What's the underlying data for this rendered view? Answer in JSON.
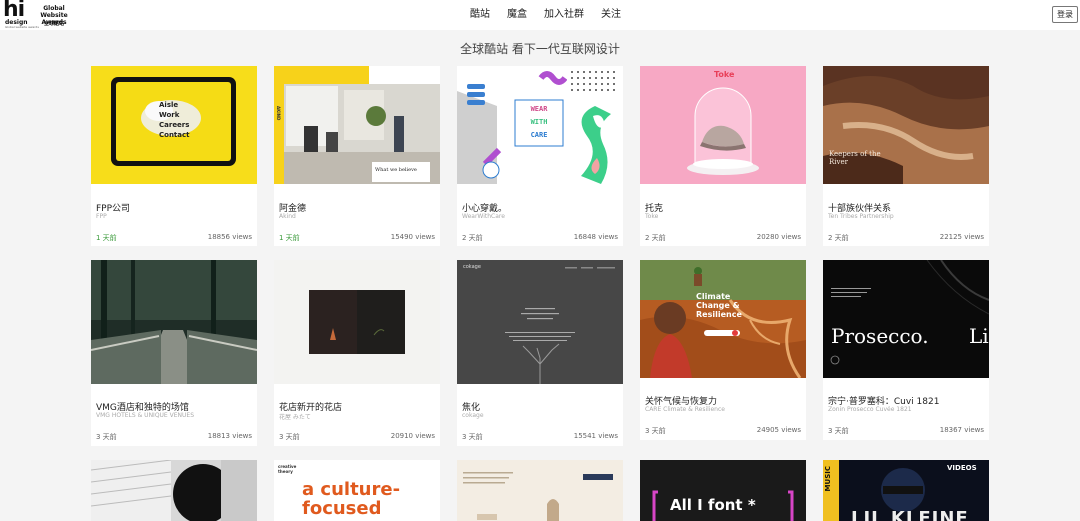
{
  "logo": {
    "hi": "hi",
    "design": "design",
    "tag": "Global website awards",
    "gwa": "Global Website Awards",
    "cn": "全球酷站"
  },
  "nav": {
    "items": [
      "酷站",
      "魔盒",
      "加入社群",
      "关注"
    ],
    "login": "登录"
  },
  "subtitle": "全球酷站 看下一代互联网设计",
  "cards": [
    {
      "title": "FPP公司",
      "sub": "FPP",
      "age": "1 天前",
      "age_new": true,
      "views": "18856 views",
      "thumb": {
        "menu": [
          "Aisle",
          "Work",
          "Careers",
          "Contact"
        ]
      }
    },
    {
      "title": "阿金德",
      "sub": "Akind",
      "age": "1 天前",
      "age_new": true,
      "views": "15490 views",
      "thumb": {
        "brand": "AKIND",
        "caption": "What we believe"
      }
    },
    {
      "title": "小心穿戴。",
      "sub": "WearWithCare",
      "age": "2 天前",
      "age_new": false,
      "views": "16848 views",
      "thumb": {
        "line1": "WEAR",
        "line2": "WITH",
        "line3": "CARE"
      }
    },
    {
      "title": "托克",
      "sub": "Toke",
      "age": "2 天前",
      "age_new": false,
      "views": "20280 views",
      "thumb": {
        "brand": "Toke"
      }
    },
    {
      "title": "十部族伙伴关系",
      "sub": "Ten Tribes Partnership",
      "age": "2 天前",
      "age_new": false,
      "views": "22125 views",
      "thumb": {
        "caption": "Keepers of the River"
      }
    },
    {
      "title": "VMG酒店和独特的场馆",
      "sub": "VMG HOTELS & UNIQUE VENUES",
      "age": "3 天前",
      "age_new": false,
      "views": "18813 views",
      "thumb": {}
    },
    {
      "title": "花店新开的花店",
      "sub": "花屋 みたて",
      "age": "3 天前",
      "age_new": false,
      "views": "20910 views",
      "thumb": {}
    },
    {
      "title": "焦化",
      "sub": "cokage",
      "age": "3 天前",
      "age_new": false,
      "views": "15541 views",
      "thumb": {
        "brand": "cokage"
      }
    },
    {
      "title": "关怀气候与恢复力",
      "sub": "CARE Climate & Resilience",
      "age": "3 天前",
      "age_new": false,
      "views": "24905 views",
      "thumb": {
        "headline": "Climate Change & Resilience"
      }
    },
    {
      "title": "宗宁·普罗塞科：Cuvi 1821",
      "sub": "Zonin Prosecco Cuvée 1821",
      "age": "3 天前",
      "age_new": false,
      "views": "18367 views",
      "thumb": {
        "headline": "Prosecco.",
        "tail": "Li"
      }
    }
  ],
  "row3": [
    {
      "text": ""
    },
    {
      "label": "creative theory",
      "headline1": "a culture-",
      "headline2": "focused"
    },
    {
      "text": ""
    },
    {
      "headline": "All I font *"
    },
    {
      "side": "MUSIC",
      "top": "VIDEOS",
      "big": "LIL KLEINE"
    }
  ],
  "colors": {
    "accent_green": "#3a9a3a",
    "background": "#f4f4f4"
  }
}
